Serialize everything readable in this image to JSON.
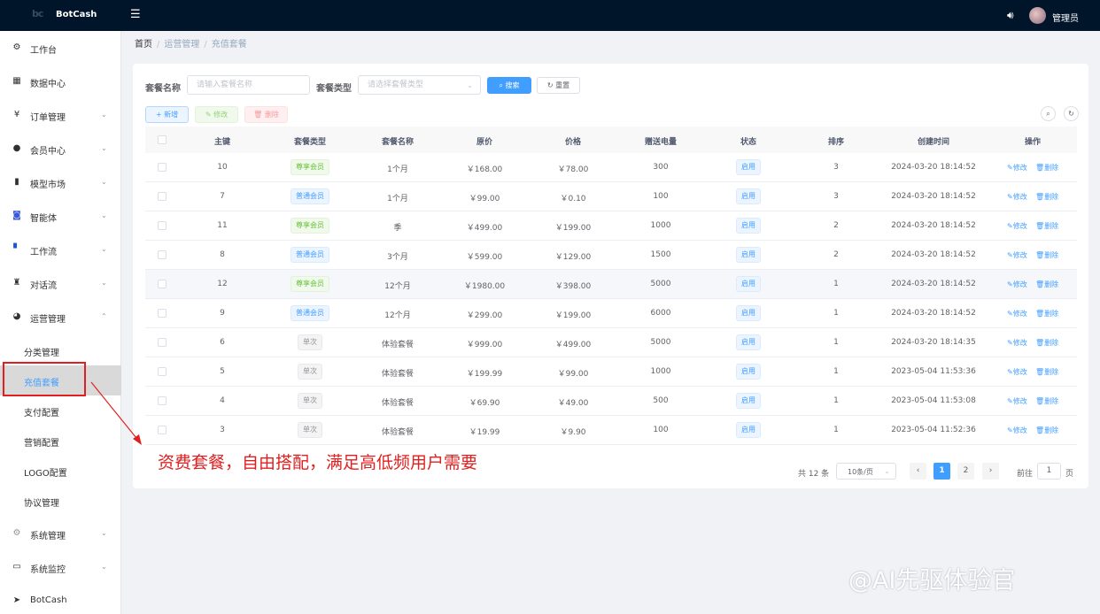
{
  "header": {
    "logo_text": "bc",
    "app_name": "BotCash",
    "user_name": "管理员"
  },
  "sidebar": {
    "items": [
      {
        "label": "工作台",
        "icon": "dashboard-icon",
        "expandable": false
      },
      {
        "label": "数据中心",
        "icon": "data-icon",
        "expandable": false
      },
      {
        "label": "订单管理",
        "icon": "yen-icon",
        "expandable": true
      },
      {
        "label": "会员中心",
        "icon": "users-icon",
        "expandable": true
      },
      {
        "label": "模型市场",
        "icon": "bar-chart-icon",
        "expandable": true
      },
      {
        "label": "智能体",
        "icon": "robot-icon",
        "expandable": true
      },
      {
        "label": "工作流",
        "icon": "workflow-icon",
        "expandable": true
      },
      {
        "label": "对话流",
        "icon": "chat-icon",
        "expandable": true
      },
      {
        "label": "运营管理",
        "icon": "globe-icon",
        "expandable": true,
        "expanded": true
      }
    ],
    "sub_items": [
      {
        "label": "分类管理",
        "active": false
      },
      {
        "label": "充值套餐",
        "active": true
      },
      {
        "label": "支付配置",
        "active": false
      },
      {
        "label": "营销配置",
        "active": false
      },
      {
        "label": "LOGO配置",
        "active": false
      },
      {
        "label": "协议管理",
        "active": false
      }
    ],
    "bottom_items": [
      {
        "label": "系统管理",
        "icon": "gear-icon",
        "expandable": true
      },
      {
        "label": "系统监控",
        "icon": "monitor-icon",
        "expandable": true
      },
      {
        "label": "BotCash",
        "icon": "send-icon",
        "expandable": false
      }
    ]
  },
  "breadcrumb": [
    "首页",
    "运营管理",
    "充值套餐"
  ],
  "search": {
    "name_label": "套餐名称",
    "name_placeholder": "请输入套餐名称",
    "type_label": "套餐类型",
    "type_placeholder": "请选择套餐类型",
    "search_button": "搜索",
    "reset_button": "重置"
  },
  "toolbar": {
    "add": "新增",
    "edit": "修改",
    "delete": "删除"
  },
  "table": {
    "columns": [
      "主键",
      "套餐类型",
      "套餐名称",
      "原价",
      "价格",
      "赠送电量",
      "状态",
      "排序",
      "创建时间",
      "操作"
    ],
    "rows": [
      {
        "id": "10",
        "type": "尊享会员",
        "type_kind": "premium",
        "name": "1个月",
        "original_price": "￥168.00",
        "price": "￥78.00",
        "bonus": "300",
        "status": "启用",
        "sort": "3",
        "created": "2024-03-20 18:14:52"
      },
      {
        "id": "7",
        "type": "普通会员",
        "type_kind": "normal",
        "name": "1个月",
        "original_price": "￥99.00",
        "price": "￥0.10",
        "bonus": "100",
        "status": "启用",
        "sort": "3",
        "created": "2024-03-20 18:14:52"
      },
      {
        "id": "11",
        "type": "尊享会员",
        "type_kind": "premium",
        "name": "季",
        "original_price": "￥499.00",
        "price": "￥199.00",
        "bonus": "1000",
        "status": "启用",
        "sort": "2",
        "created": "2024-03-20 18:14:52"
      },
      {
        "id": "8",
        "type": "普通会员",
        "type_kind": "normal",
        "name": "3个月",
        "original_price": "￥599.00",
        "price": "￥129.00",
        "bonus": "1500",
        "status": "启用",
        "sort": "2",
        "created": "2024-03-20 18:14:52"
      },
      {
        "id": "12",
        "type": "尊享会员",
        "type_kind": "premium",
        "name": "12个月",
        "original_price": "￥1980.00",
        "price": "￥398.00",
        "bonus": "5000",
        "status": "启用",
        "sort": "1",
        "created": "2024-03-20 18:14:52"
      },
      {
        "id": "9",
        "type": "普通会员",
        "type_kind": "normal",
        "name": "12个月",
        "original_price": "￥299.00",
        "price": "￥199.00",
        "bonus": "6000",
        "status": "启用",
        "sort": "1",
        "created": "2024-03-20 18:14:52"
      },
      {
        "id": "6",
        "type": "单次",
        "type_kind": "single",
        "name": "体验套餐",
        "original_price": "￥999.00",
        "price": "￥499.00",
        "bonus": "5000",
        "status": "启用",
        "sort": "1",
        "created": "2024-03-20 18:14:35"
      },
      {
        "id": "5",
        "type": "单次",
        "type_kind": "single",
        "name": "体验套餐",
        "original_price": "￥199.99",
        "price": "￥99.00",
        "bonus": "1000",
        "status": "启用",
        "sort": "1",
        "created": "2023-05-04 11:53:36"
      },
      {
        "id": "4",
        "type": "单次",
        "type_kind": "single",
        "name": "体验套餐",
        "original_price": "￥69.90",
        "price": "￥49.00",
        "bonus": "500",
        "status": "启用",
        "sort": "1",
        "created": "2023-05-04 11:53:08"
      },
      {
        "id": "3",
        "type": "单次",
        "type_kind": "single",
        "name": "体验套餐",
        "original_price": "￥19.99",
        "price": "￥9.90",
        "bonus": "100",
        "status": "启用",
        "sort": "1",
        "created": "2023-05-04 11:52:36"
      }
    ],
    "row_edit": "修改",
    "row_delete": "删除"
  },
  "pagination": {
    "total": "共 12 条",
    "page_size": "10条/页",
    "pages": [
      "1",
      "2"
    ],
    "current": "1",
    "goto_label": "前往",
    "goto_value": "1",
    "goto_suffix": "页"
  },
  "annotation": "资费套餐，自由搭配，满足高低频用户需要",
  "watermark": "@AI先驱体验官",
  "colors": {
    "header_bg": "#001529",
    "primary": "#409eff",
    "annotation_red": "#e02020"
  }
}
